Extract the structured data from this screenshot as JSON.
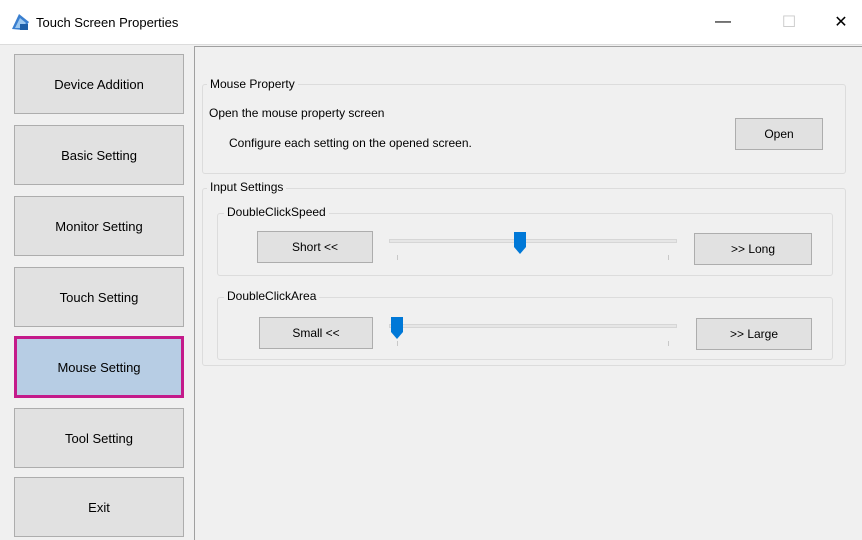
{
  "window": {
    "title": "Touch Screen Properties",
    "minimize_glyph": "—",
    "maximize_glyph": "☐",
    "close_glyph": "✕"
  },
  "sidebar": {
    "items": [
      {
        "label": "Device Addition",
        "active": false
      },
      {
        "label": "Basic Setting",
        "active": false
      },
      {
        "label": "Monitor Setting",
        "active": false
      },
      {
        "label": "Touch Setting",
        "active": false
      },
      {
        "label": "Mouse Setting",
        "active": true
      },
      {
        "label": "Tool Setting",
        "active": false
      },
      {
        "label": "Exit",
        "active": false
      }
    ],
    "highlight_color": "#c41a8a",
    "active_bg": "#b7cde4"
  },
  "mouse_property": {
    "group_label": "Mouse Property",
    "description": "Open the mouse property screen",
    "instruction": "Configure each setting on the opened screen.",
    "open_button": "Open"
  },
  "input_settings": {
    "group_label": "Input Settings",
    "double_click_speed": {
      "label": "DoubleClickSpeed",
      "left_button": "Short <<",
      "right_button": ">> Long",
      "value_fraction": 0.45
    },
    "double_click_area": {
      "label": "DoubleClickArea",
      "left_button": "Small <<",
      "right_button": ">> Large",
      "value_fraction": 0.0
    }
  },
  "colors": {
    "slider_thumb": "#0078d7"
  }
}
